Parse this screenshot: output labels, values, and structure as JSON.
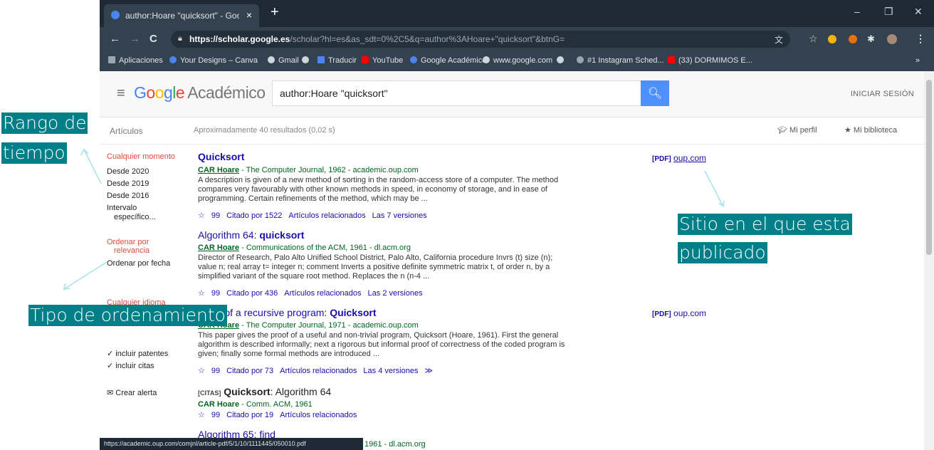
{
  "browser": {
    "tab_title": "author:Hoare \"quicksort\" - Goo...",
    "tab_close": "×",
    "new_tab": "+",
    "window_minimize": "–",
    "window_maximize": "❐",
    "window_close": "✕",
    "nav_back": "←",
    "nav_forward": "→",
    "nav_reload": "C",
    "url_host": "https://scholar.google.es",
    "url_rest": "/scholar?hl=es&as_sdt=0%2C5&q=author%3AHoare+\"quicksort\"&btnG=",
    "bookmarks": [
      {
        "label": "Aplicaciones",
        "color": "#9aa6b1"
      },
      {
        "label": "Your Designs – Canva",
        "color": "#4b86f0"
      },
      {
        "label": "Gmail",
        "color": "#cfd6dc"
      },
      {
        "label": "Traducir",
        "color": "#4b86f0"
      },
      {
        "label": "YouTube",
        "color": "#ff0000"
      },
      {
        "label": "Google Académico",
        "color": "#4b86f0"
      },
      {
        "label": "www.google.com",
        "color": "#cfd6dc"
      },
      {
        "label": "#1 Instagram Sched...",
        "color": "#9aa6b1"
      },
      {
        "label": "(33) DORMIMOS E...",
        "color": "#ff0000"
      }
    ]
  },
  "scholar": {
    "logo_google": "Google",
    "logo_sub": "Académico",
    "search_value": "author:Hoare \"quicksort\"",
    "sign_in": "INICIAR SESIÓN",
    "articles_label": "Artículos",
    "results_count": "Aproximadamente 40 resultados (0,02 s)",
    "my_profile": "Mi perfil",
    "my_library": "Mi biblioteca",
    "sidebar": {
      "time_any": "Cualquier momento",
      "since_2020": "Desde 2020",
      "since_2019": "Desde 2019",
      "since_2016": "Desde 2016",
      "range_1": "Intervalo",
      "range_2": "específico...",
      "sort_rel_1": "Ordenar por",
      "sort_rel_2": "relevancia",
      "sort_date": "Ordenar por fecha",
      "any_lang": "Cualquier idioma",
      "patents": "incluir patentes",
      "citations": "incluir citas",
      "alert": "Crear alerta"
    },
    "results": [
      {
        "title": "Quicksort",
        "author": "CAR Hoare",
        "meta": " - The Computer Journal, 1962 - academic.oup.com",
        "snippet": "A description is given of a new method of sorting in the random-access store of a computer. The method compares very favourably with other known methods in speed, in economy of storage, and in ease of programming. Certain refinements of the method, which may be ...",
        "cited": "Citado por 1522",
        "related": "Artículos relacionados",
        "versions": "Las 7 versiones",
        "pdf_tag": "[PDF]",
        "pdf_site": "oup.com"
      },
      {
        "title_pre": "Algorithm 64: ",
        "title_bold": "quicksort",
        "author": "CAR Hoare",
        "meta": " - Communications of the ACM, 1961 - dl.acm.org",
        "snippet": "Director of Research, Palo Alto Unified School District, Palo Alto, California procedure Invrs (t) size (n); value n; real array t= integer n; comment Inverts a positive definite symmetric matrix t, of order n, by a simplified variant of the square root method. Replaces the n (n-4 ...",
        "cited": "Citado por 436",
        "related": "Artículos relacionados",
        "versions": "Las 2 versiones"
      },
      {
        "title_pre": "Proof of a recursive program: ",
        "title_bold": "Quicksort",
        "author": "CAR Hoare",
        "meta": " - The Computer Journal, 1971 - academic.oup.com",
        "snippet": "This paper gives the proof of a useful and non-trivial program, Quicksort (Hoare, 1961). First the general algorithm is described informally; next a rigorous but informal proof of correctness of the coded program is given; finally some formal methods are introduced ...",
        "cited": "Citado por 73",
        "related": "Artículos relacionados",
        "versions": "Las 4 versiones",
        "more": "≫",
        "pdf_tag": "[PDF]",
        "pdf_site": "oup.com"
      },
      {
        "cite_tag": "[CITAS]",
        "title_bold": "Quicksort",
        "title_post": ": Algorithm 64",
        "author": "CAR Hoare",
        "meta": " - Comm. ACM, 1961",
        "cited": "Citado por 19",
        "related": "Artículos relacionados"
      },
      {
        "title_pre": "Algorithm 65: find",
        "meta": "1961 - dl.acm.org"
      }
    ],
    "status_url": "https://academic.oup.com/comjnl/article-pdf/5/1/10/1111445/050010.pdf"
  },
  "annotations": {
    "time_range_1": "Rango  de",
    "time_range_2": "tiempo",
    "site_1": "Sitio en el que esta",
    "site_2": "publicado",
    "sort_type": "Tipo de ordenamiento"
  },
  "colors": {
    "annotation_bg": "#007f88",
    "link": "#1a0dab",
    "source_green": "#006621",
    "search_blue": "#4d90fe"
  }
}
